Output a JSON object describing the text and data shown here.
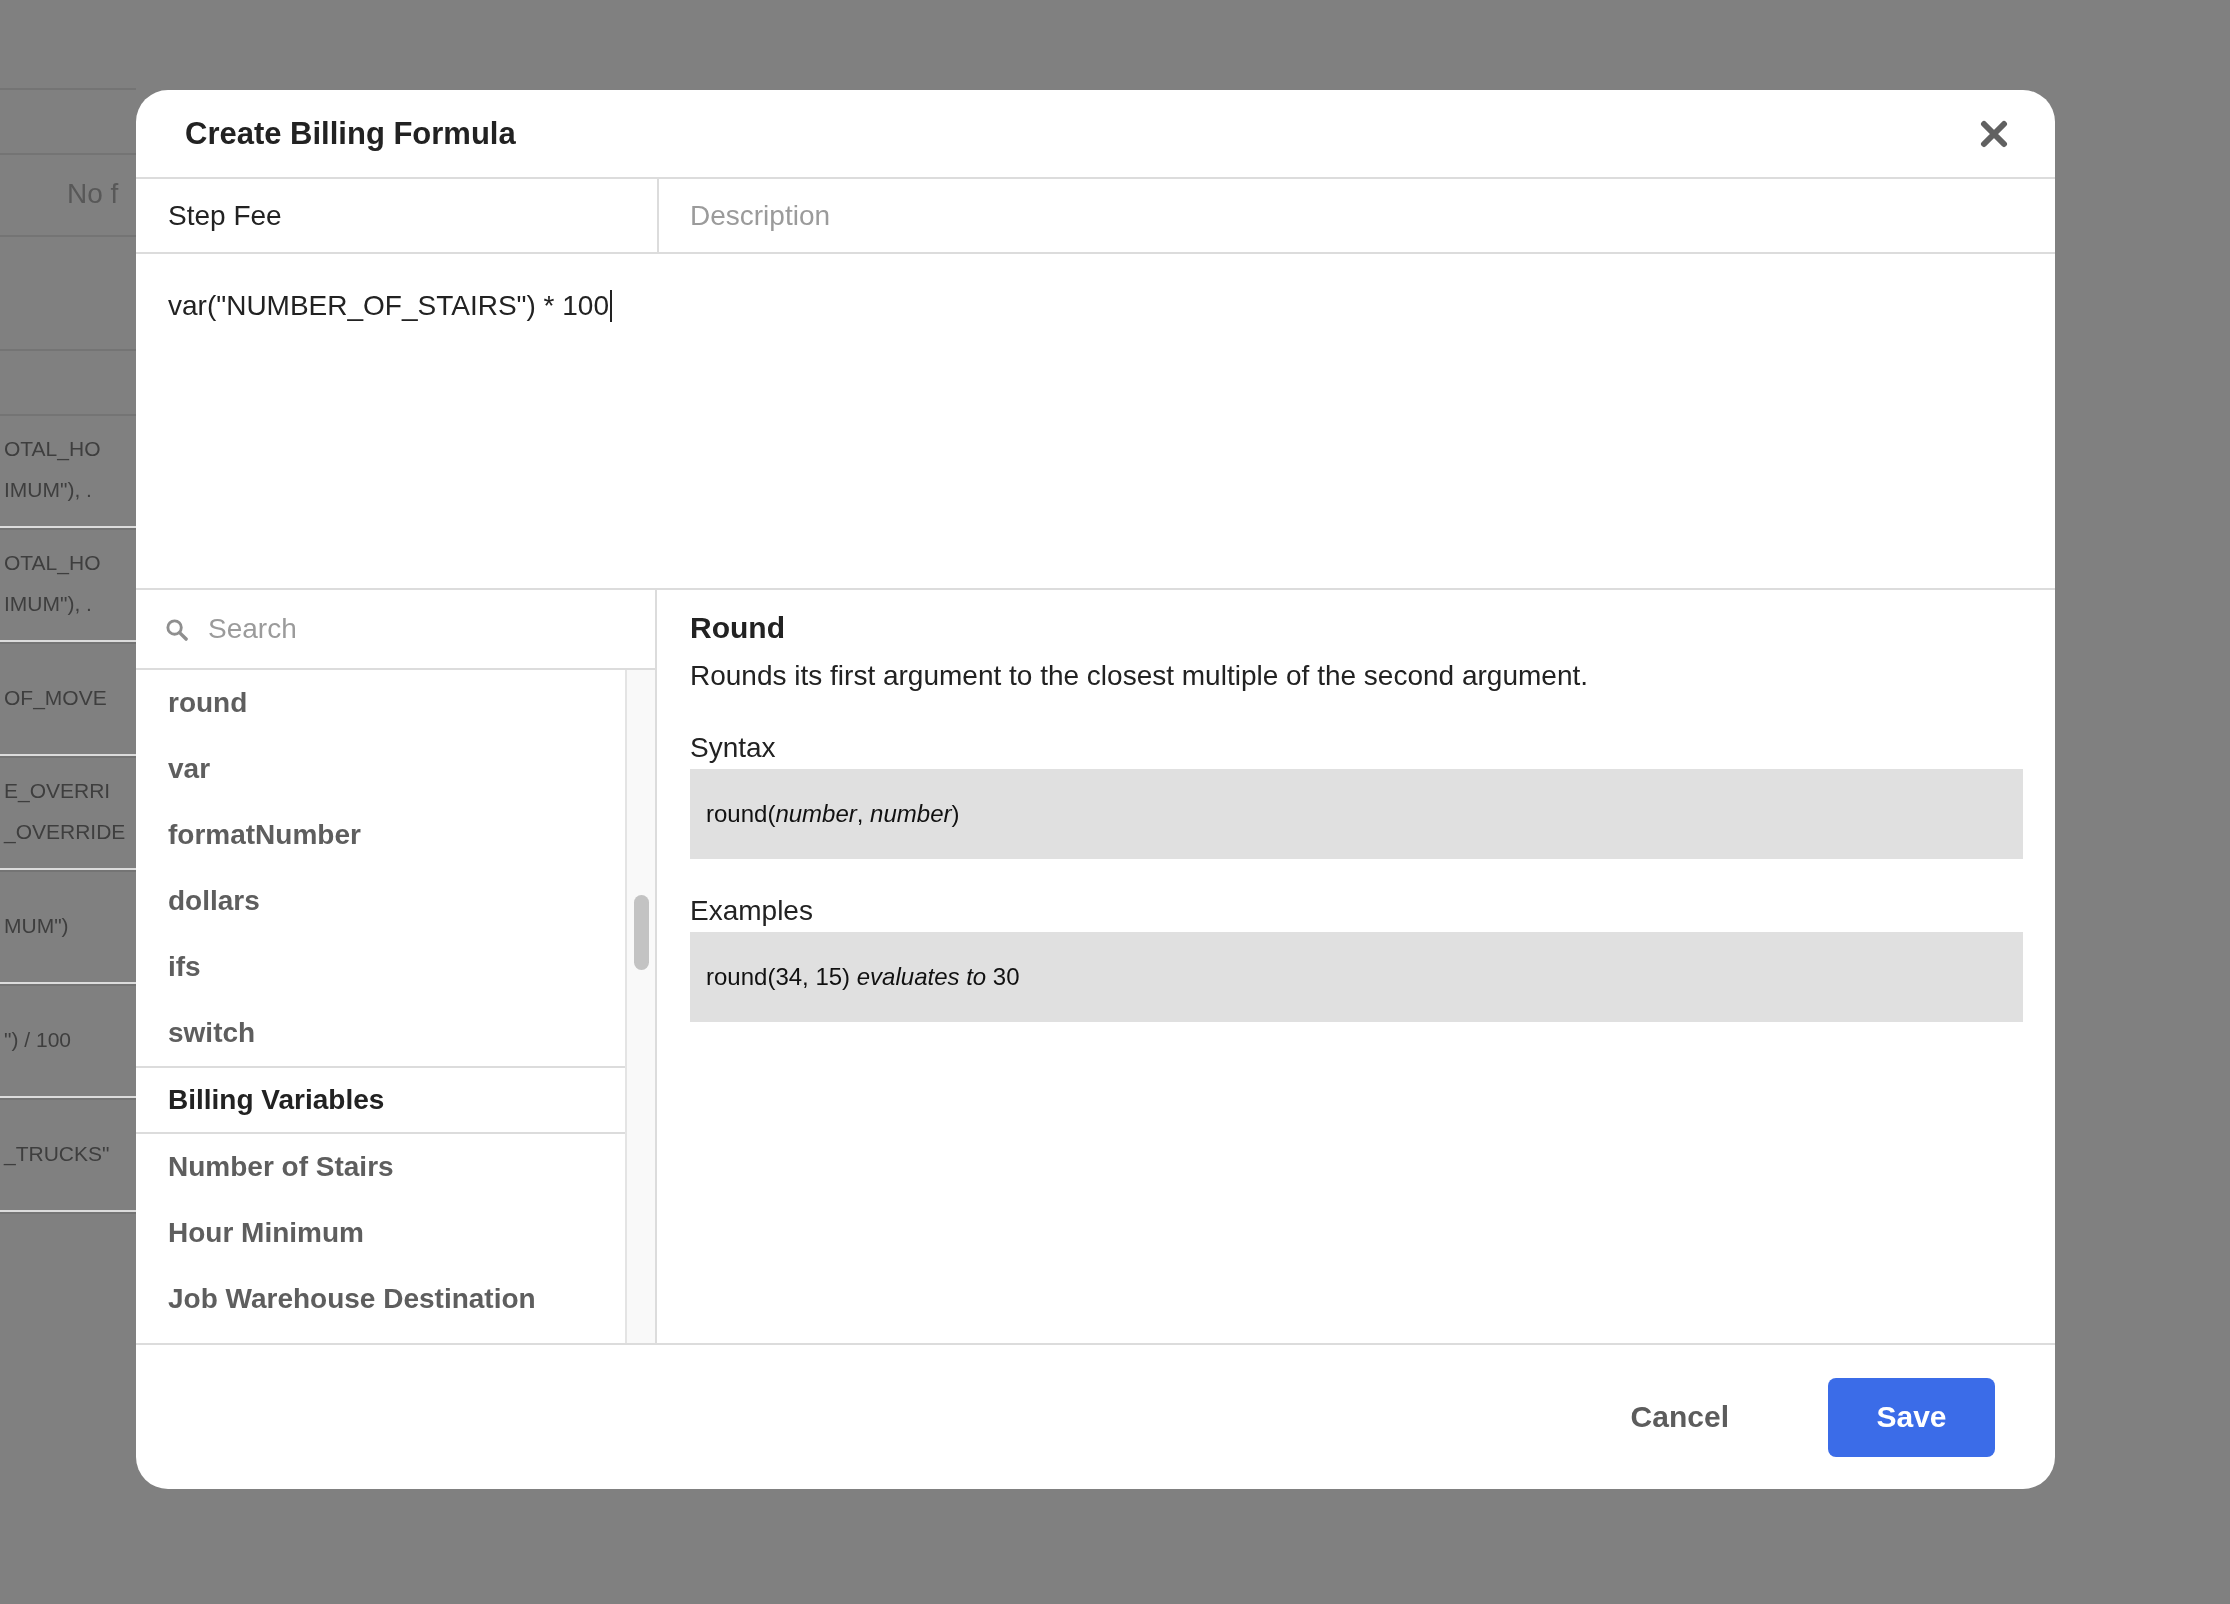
{
  "background": {
    "sections": [
      {
        "rows": [
          {
            "kind": "message",
            "lines": [
              "No f"
            ]
          }
        ]
      },
      {
        "rows": [
          {
            "kind": "formula",
            "lines": [
              "OTAL_HO",
              "IMUM\"), ."
            ]
          },
          {
            "kind": "formula",
            "lines": [
              "OTAL_HO",
              "IMUM\"), ."
            ]
          },
          {
            "kind": "formula",
            "lines": [
              "OF_MOVE"
            ]
          },
          {
            "kind": "formula",
            "lines": [
              "E_OVERRI",
              "_OVERRIDE"
            ]
          },
          {
            "kind": "formula",
            "lines": [
              "MUM\")"
            ]
          },
          {
            "kind": "formula",
            "lines": [
              "\") / 100"
            ]
          },
          {
            "kind": "formula",
            "lines": [
              "_TRUCKS\""
            ]
          }
        ]
      }
    ]
  },
  "dialog": {
    "title": "Create Billing Formula"
  },
  "name_field": {
    "value": "Step Fee"
  },
  "description_field": {
    "placeholder": "Description"
  },
  "formula_editor": {
    "value": "var(\"NUMBER_OF_STAIRS\") * 100",
    "focused": true
  },
  "search": {
    "placeholder": "Search"
  },
  "reference_list": {
    "groups": [
      {
        "items": [
          "round",
          "var",
          "formatNumber",
          "dollars",
          "ifs",
          "switch"
        ]
      },
      {
        "heading": "Billing Variables",
        "items": [
          "Number of Stairs",
          "Hour Minimum",
          "Job Warehouse Destination"
        ]
      }
    ]
  },
  "detail": {
    "title": "Round",
    "description": "Rounds its first argument to the closest multiple of the second argument.",
    "syntax_label": "Syntax",
    "syntax": "round(*number*, *number*)",
    "examples_label": "Examples",
    "examples": [
      "round(34, 15) *evaluates to* 30"
    ]
  },
  "buttons": [
    {
      "kind": "secondary",
      "label": "Cancel"
    },
    {
      "kind": "primary",
      "label": "Save"
    }
  ]
}
